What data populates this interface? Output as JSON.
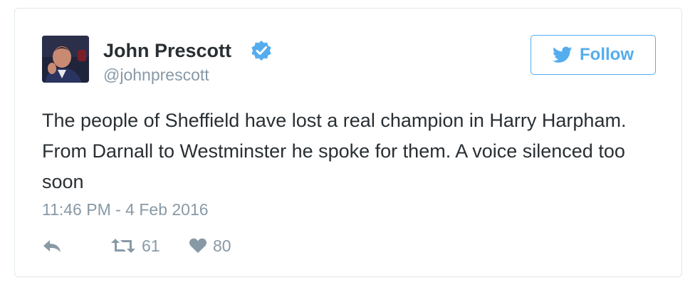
{
  "author": {
    "display_name": "John Prescott",
    "handle": "@johnprescott",
    "verified": true
  },
  "follow_button": {
    "label": "Follow"
  },
  "tweet": {
    "text": "The people of Sheffield have lost a real champion in Harry Harpham. From Darnall to Westminster he spoke for them. A voice silenced too soon",
    "timestamp": "11:46 PM - 4 Feb 2016"
  },
  "actions": {
    "retweet_count": "61",
    "like_count": "80"
  },
  "icons": {
    "avatar": "avatar-photo",
    "verified": "verified-badge-icon",
    "follow": "twitter-bird-icon",
    "reply": "reply-icon",
    "retweet": "retweet-icon",
    "like": "heart-icon"
  },
  "colors": {
    "accent": "#55acee",
    "text": "#292f33",
    "muted": "#8899a6",
    "border": "#e1e8ed"
  }
}
